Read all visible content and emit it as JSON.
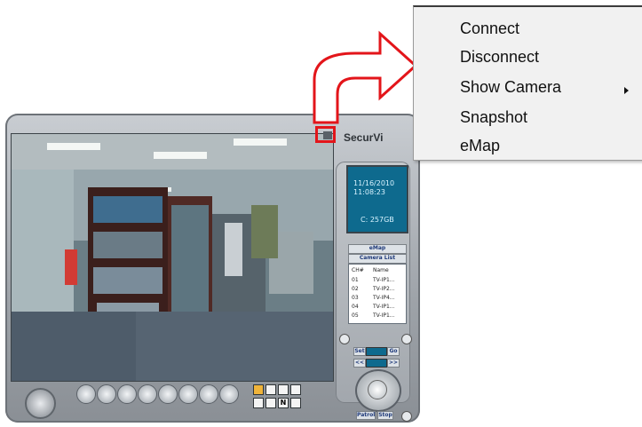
{
  "app": {
    "brand": "SecurVi",
    "lcd": {
      "date": "11/16/2010",
      "time": "11:08:23",
      "capacity": "C: 257GB"
    },
    "emap_button": "eMap",
    "camera_list_button": "Camera List",
    "camera_list": {
      "headers": [
        "CH#",
        "Name"
      ],
      "rows": [
        {
          "ch": "01",
          "name": "TV-IP1..."
        },
        {
          "ch": "02",
          "name": "TV-IP2..."
        },
        {
          "ch": "03",
          "name": "TV-IP4..."
        },
        {
          "ch": "04",
          "name": "TV-IP1..."
        },
        {
          "ch": "05",
          "name": "TV-IP1..."
        }
      ]
    },
    "ptz": {
      "set": "Set",
      "go": "Go",
      "prev": "<<",
      "next": ">>",
      "patrol": "Patrol",
      "stop": "Stop"
    },
    "layout_buttons": [
      "1",
      "4",
      "9",
      "16",
      "N",
      "full"
    ],
    "colors": {
      "lcd": "#0e6a8e",
      "highlight": "#e3151a",
      "panel": "#b7bbc0"
    }
  },
  "context_menu": {
    "items": [
      {
        "label": "Connect"
      },
      {
        "label": "Disconnect"
      },
      {
        "label": "Show Camera",
        "submenu": true
      },
      {
        "label": "Snapshot"
      },
      {
        "label": "eMap"
      }
    ]
  },
  "callout": {
    "color": "#e3151a"
  }
}
